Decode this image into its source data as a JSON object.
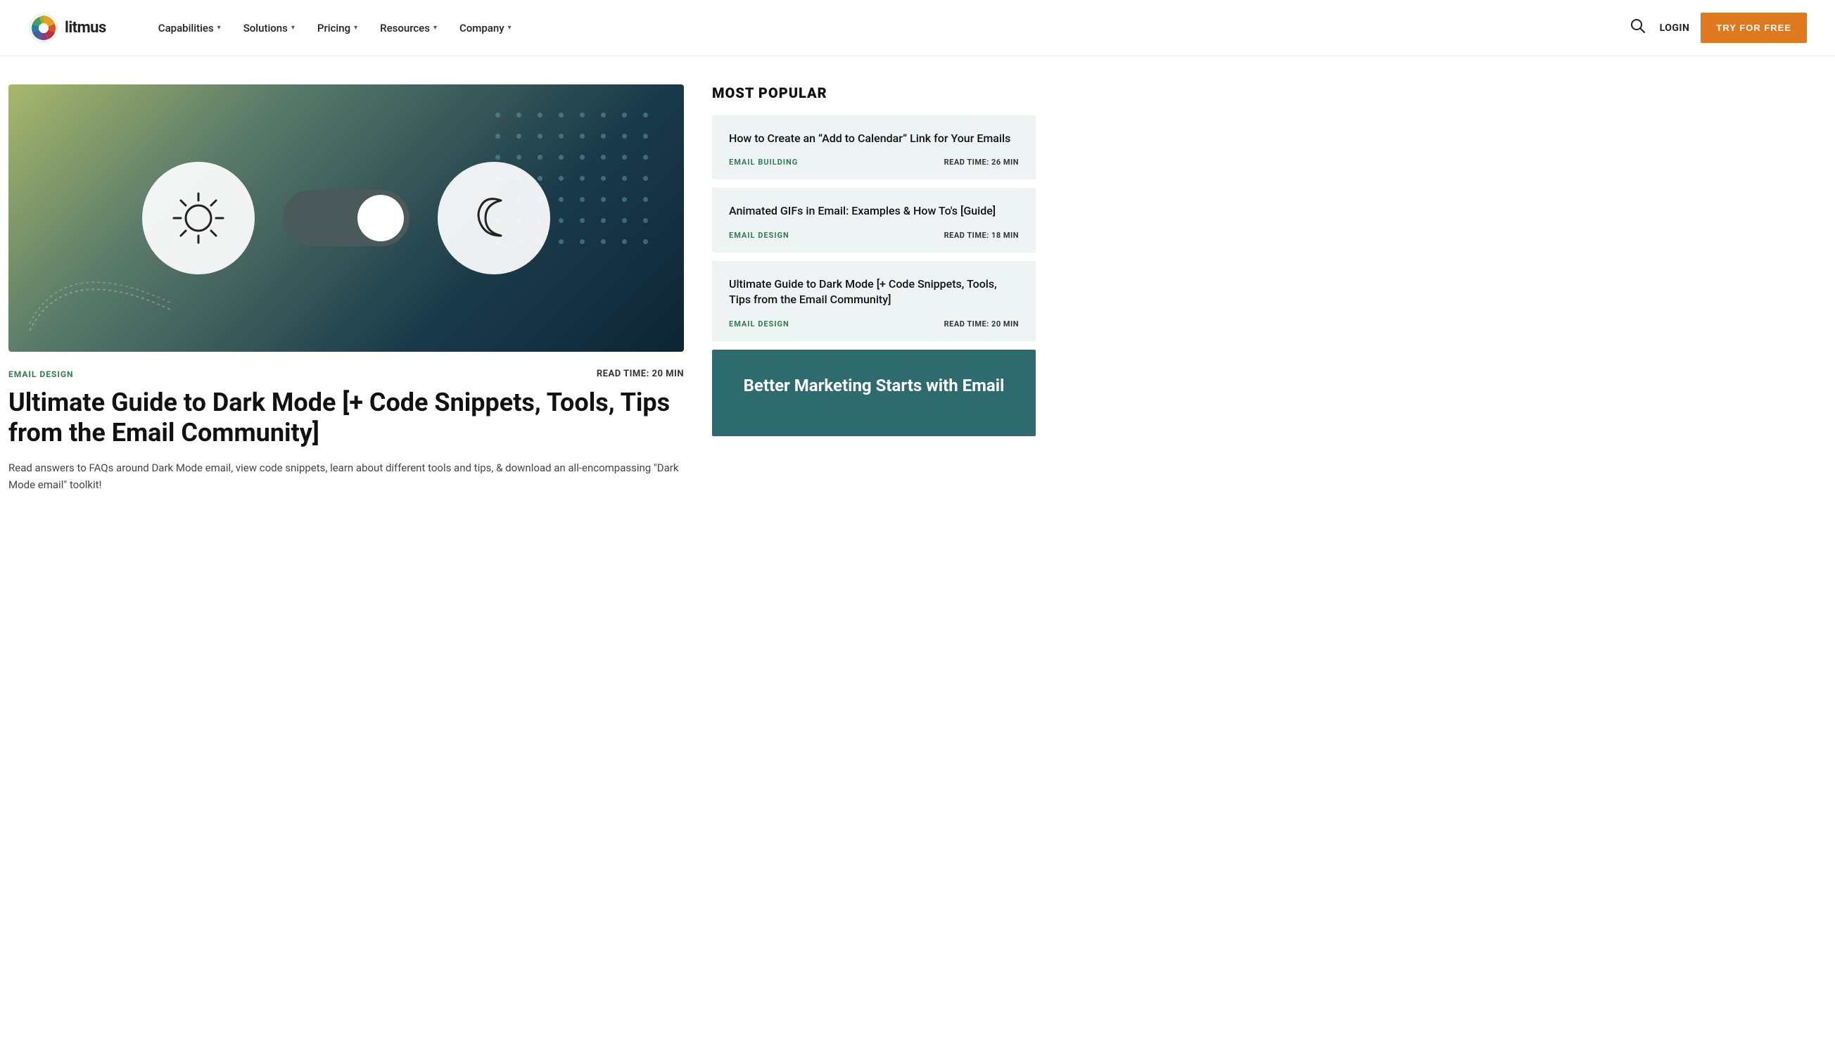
{
  "nav": {
    "logo_text": "litmus",
    "items": [
      {
        "label": "Capabilities",
        "has_dropdown": true
      },
      {
        "label": "Solutions",
        "has_dropdown": true
      },
      {
        "label": "Pricing",
        "has_dropdown": true
      },
      {
        "label": "Resources",
        "has_dropdown": true
      },
      {
        "label": "Company",
        "has_dropdown": true
      }
    ],
    "login_label": "LOGIN",
    "cta_label": "TRY FOR FREE"
  },
  "article": {
    "category": "EMAIL DESIGN",
    "read_time": "READ TIME: 20 MIN",
    "title": "Ultimate Guide to Dark Mode [+ Code Snippets, Tools, Tips from the Email Community]",
    "description": "Read answers to FAQs around Dark Mode email, view code snippets, learn about different tools and tips, & download an all-encompassing \"Dark Mode email\" toolkit!"
  },
  "sidebar": {
    "most_popular_heading": "MOST POPULAR",
    "cards": [
      {
        "title": "How to Create an “Add to Calendar” Link for Your Emails",
        "category": "EMAIL BUILDING",
        "read_time": "READ TIME: 26 MIN"
      },
      {
        "title": "Animated GIFs in Email: Examples & How To's [Guide]",
        "category": "EMAIL DESIGN",
        "read_time": "READ TIME: 18 MIN"
      },
      {
        "title": "Ultimate Guide to Dark Mode [+ Code Snippets, Tools, Tips from the Email Community]",
        "category": "EMAIL DESIGN",
        "read_time": "READ TIME: 20 MIN"
      }
    ],
    "cta": {
      "title": "Better Marketing Starts with Email"
    }
  }
}
